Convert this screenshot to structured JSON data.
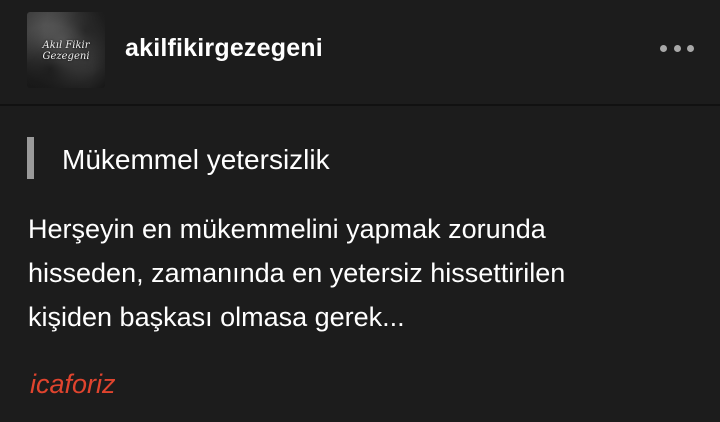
{
  "post": {
    "blog_name": "akilfikirgezegeni",
    "avatar_text_line1": "Akıl Fikir",
    "avatar_text_line2": "Gezegeni",
    "heading": "Mükemmel yetersizlik",
    "body_lines": [
      "Herşeyin en mükemmelini yapmak zorunda",
      "hisseden, zamanında en yetersiz hissettirilen",
      "kişiden başkası olmasa gerek..."
    ],
    "tag": "icaforiz"
  },
  "icons": {
    "avatar": "blog-avatar-image",
    "more": "more-options-icon",
    "quote": "quote-bar"
  },
  "colors": {
    "background": "#1c1c1c",
    "text": "#ffffff",
    "tag": "#e0442e",
    "quote_bar": "#9a9a9a",
    "more_dots": "#a8a8a8"
  }
}
